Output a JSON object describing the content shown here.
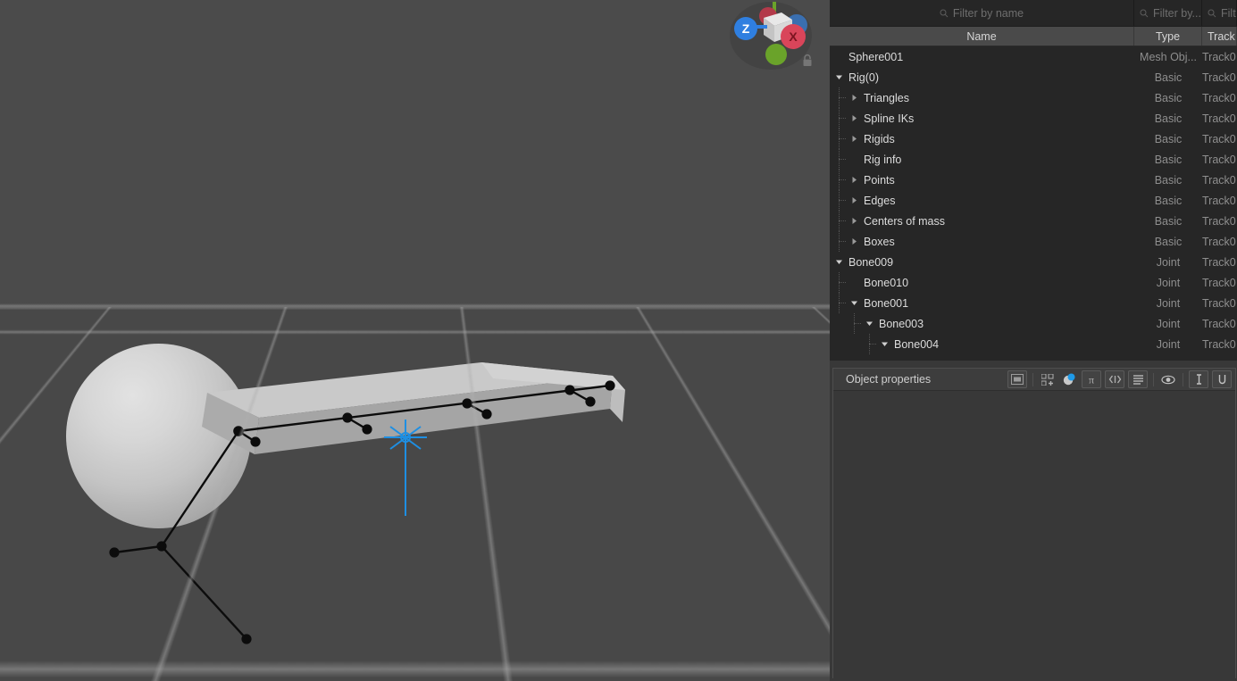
{
  "app": {
    "viewport_bg": "#4a4a4a",
    "panel_bg": "#383838",
    "accent": "#2f9ae0"
  },
  "viewport": {
    "name": "3d-viewport",
    "gizmo": {
      "x_label": "X",
      "z_label": "Z",
      "lock_icon": "lock-icon",
      "cube_icon": "view-cube-icon",
      "x_color": "#d9455a",
      "z_color": "#2f7fe0",
      "y_color": "#6aa32a",
      "back_color": "#3a6fb0"
    },
    "scene": {
      "sphere_name": "sphere-mesh",
      "beam_name": "box-beam-mesh",
      "bone_chain_name": "bone-chain",
      "pivot_name": "pivot-marker",
      "grid_name": "ground-grid"
    }
  },
  "outliner": {
    "filters": [
      {
        "name": "filter-by-name-input",
        "placeholder": "Filter by name"
      },
      {
        "name": "filter-by-type-input",
        "placeholder": "Filter by..."
      },
      {
        "name": "filter-by-track-input",
        "placeholder": "Filte."
      }
    ],
    "columns": [
      {
        "label": "Name"
      },
      {
        "label": "Type"
      },
      {
        "label": "Track"
      }
    ],
    "rows": [
      {
        "label": "Sphere001",
        "type": "Mesh Obj...",
        "track": "Track0",
        "depth": 0,
        "arrow": "none"
      },
      {
        "label": "Rig(0)",
        "type": "Basic",
        "track": "Track0",
        "depth": 0,
        "arrow": "down"
      },
      {
        "label": "Triangles",
        "type": "Basic",
        "track": "Track0",
        "depth": 1,
        "arrow": "right"
      },
      {
        "label": "Spline IKs",
        "type": "Basic",
        "track": "Track0",
        "depth": 1,
        "arrow": "right"
      },
      {
        "label": "Rigids",
        "type": "Basic",
        "track": "Track0",
        "depth": 1,
        "arrow": "right"
      },
      {
        "label": "Rig info",
        "type": "Basic",
        "track": "Track0",
        "depth": 1,
        "arrow": "none"
      },
      {
        "label": "Points",
        "type": "Basic",
        "track": "Track0",
        "depth": 1,
        "arrow": "right"
      },
      {
        "label": "Edges",
        "type": "Basic",
        "track": "Track0",
        "depth": 1,
        "arrow": "right"
      },
      {
        "label": "Centers of mass",
        "type": "Basic",
        "track": "Track0",
        "depth": 1,
        "arrow": "right"
      },
      {
        "label": "Boxes",
        "type": "Basic",
        "track": "Track0",
        "depth": 1,
        "arrow": "right"
      },
      {
        "label": "Bone009",
        "type": "Joint",
        "track": "Track0",
        "depth": 0,
        "arrow": "down"
      },
      {
        "label": "Bone010",
        "type": "Joint",
        "track": "Track0",
        "depth": 1,
        "arrow": "none"
      },
      {
        "label": "Bone001",
        "type": "Joint",
        "track": "Track0",
        "depth": 1,
        "arrow": "down"
      },
      {
        "label": "Bone003",
        "type": "Joint",
        "track": "Track0",
        "depth": 2,
        "arrow": "down"
      },
      {
        "label": "Bone004",
        "type": "Joint",
        "track": "Track0",
        "depth": 3,
        "arrow": "down"
      }
    ]
  },
  "object_properties": {
    "title": "Object properties",
    "tools": [
      {
        "name": "panel-layout-icon",
        "glyph": "panel"
      },
      {
        "name": "separator",
        "glyph": "sep"
      },
      {
        "name": "rig-nodes-icon",
        "glyph": "nodes"
      },
      {
        "name": "material-sphere-icon",
        "glyph": "matsphere"
      },
      {
        "name": "physics-pi-icon",
        "glyph": "pi"
      },
      {
        "name": "code-brackets-icon",
        "glyph": "code"
      },
      {
        "name": "list-lines-icon",
        "glyph": "list"
      },
      {
        "name": "separator",
        "glyph": "sep"
      },
      {
        "name": "visibility-eye-icon",
        "glyph": "eye"
      },
      {
        "name": "separator",
        "glyph": "sep"
      },
      {
        "name": "text-tool-icon",
        "glyph": "textI"
      },
      {
        "name": "unit-tool-icon",
        "glyph": "unitU"
      }
    ]
  }
}
